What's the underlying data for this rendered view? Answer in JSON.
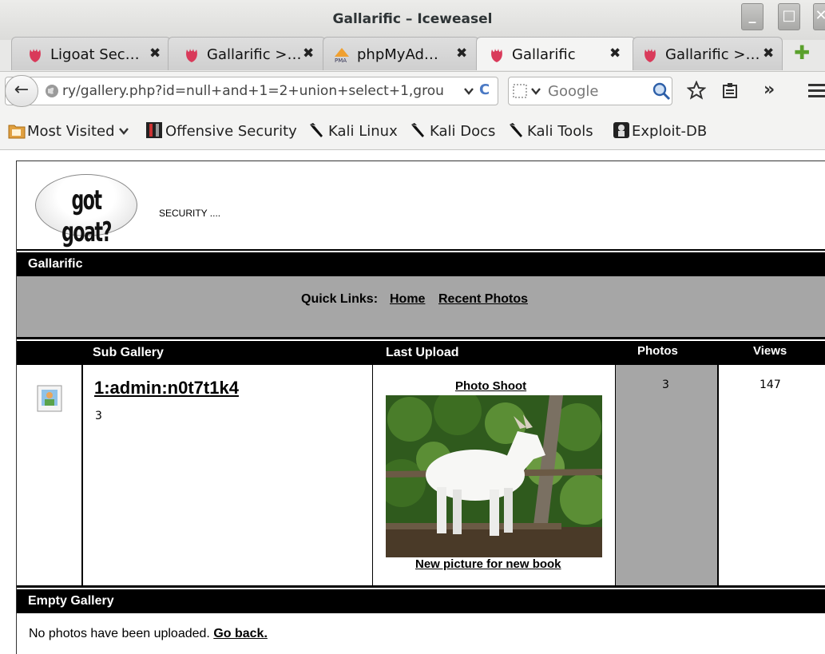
{
  "window": {
    "title": "Gallarific – Iceweasel",
    "minimize_label": "_",
    "maximize_label": "□",
    "close_label": "✕"
  },
  "tabs": [
    {
      "label": "Ligoat Sec…",
      "icon": "iceweasel-flame-icon"
    },
    {
      "label": "Gallarific >…",
      "icon": "iceweasel-flame-icon"
    },
    {
      "label": "phpMyAd…",
      "icon": "phpmyadmin-icon"
    },
    {
      "label": "Gallarific",
      "icon": "iceweasel-flame-icon",
      "active": true
    },
    {
      "label": "Gallarific >…",
      "icon": "iceweasel-flame-icon"
    }
  ],
  "tab_close": "✖",
  "newtab_label": "✚",
  "navbar": {
    "url": "ry/gallery.php?id=null+and+1=2+union+select+1,grou",
    "search_placeholder": "Google",
    "back": "←",
    "reload": "C",
    "overflow": "»"
  },
  "bookmarks": [
    {
      "label": "Most Visited",
      "icon": "folder-icon",
      "dropdown": true
    },
    {
      "label": "Offensive Security",
      "icon": "offsec-icon"
    },
    {
      "label": "Kali Linux",
      "icon": "kali-dragon-icon"
    },
    {
      "label": "Kali Docs",
      "icon": "kali-dragon-icon"
    },
    {
      "label": "Kali Tools",
      "icon": "kali-dragon-icon"
    },
    {
      "label": "Exploit-DB",
      "icon": "exploitdb-icon"
    }
  ],
  "page": {
    "logo_text": "got goat?",
    "tagline": "SECURITY ....",
    "gallery_header": "Gallarific",
    "quick_links_label": "Quick Links:",
    "quick_links": [
      "Home",
      "Recent Photos"
    ],
    "table_headers": [
      "Sub Gallery",
      "Last Upload",
      "Photos",
      "Views"
    ],
    "row": {
      "name": "1:admin:n0t7t1k4",
      "subcount": "3",
      "upload_title": "Photo Shoot",
      "upload_caption": "New picture for new book",
      "photos": "3",
      "views": "147"
    },
    "empty_header": "Empty Gallery",
    "empty_text": "No photos have been uploaded.",
    "go_back": "Go back."
  }
}
